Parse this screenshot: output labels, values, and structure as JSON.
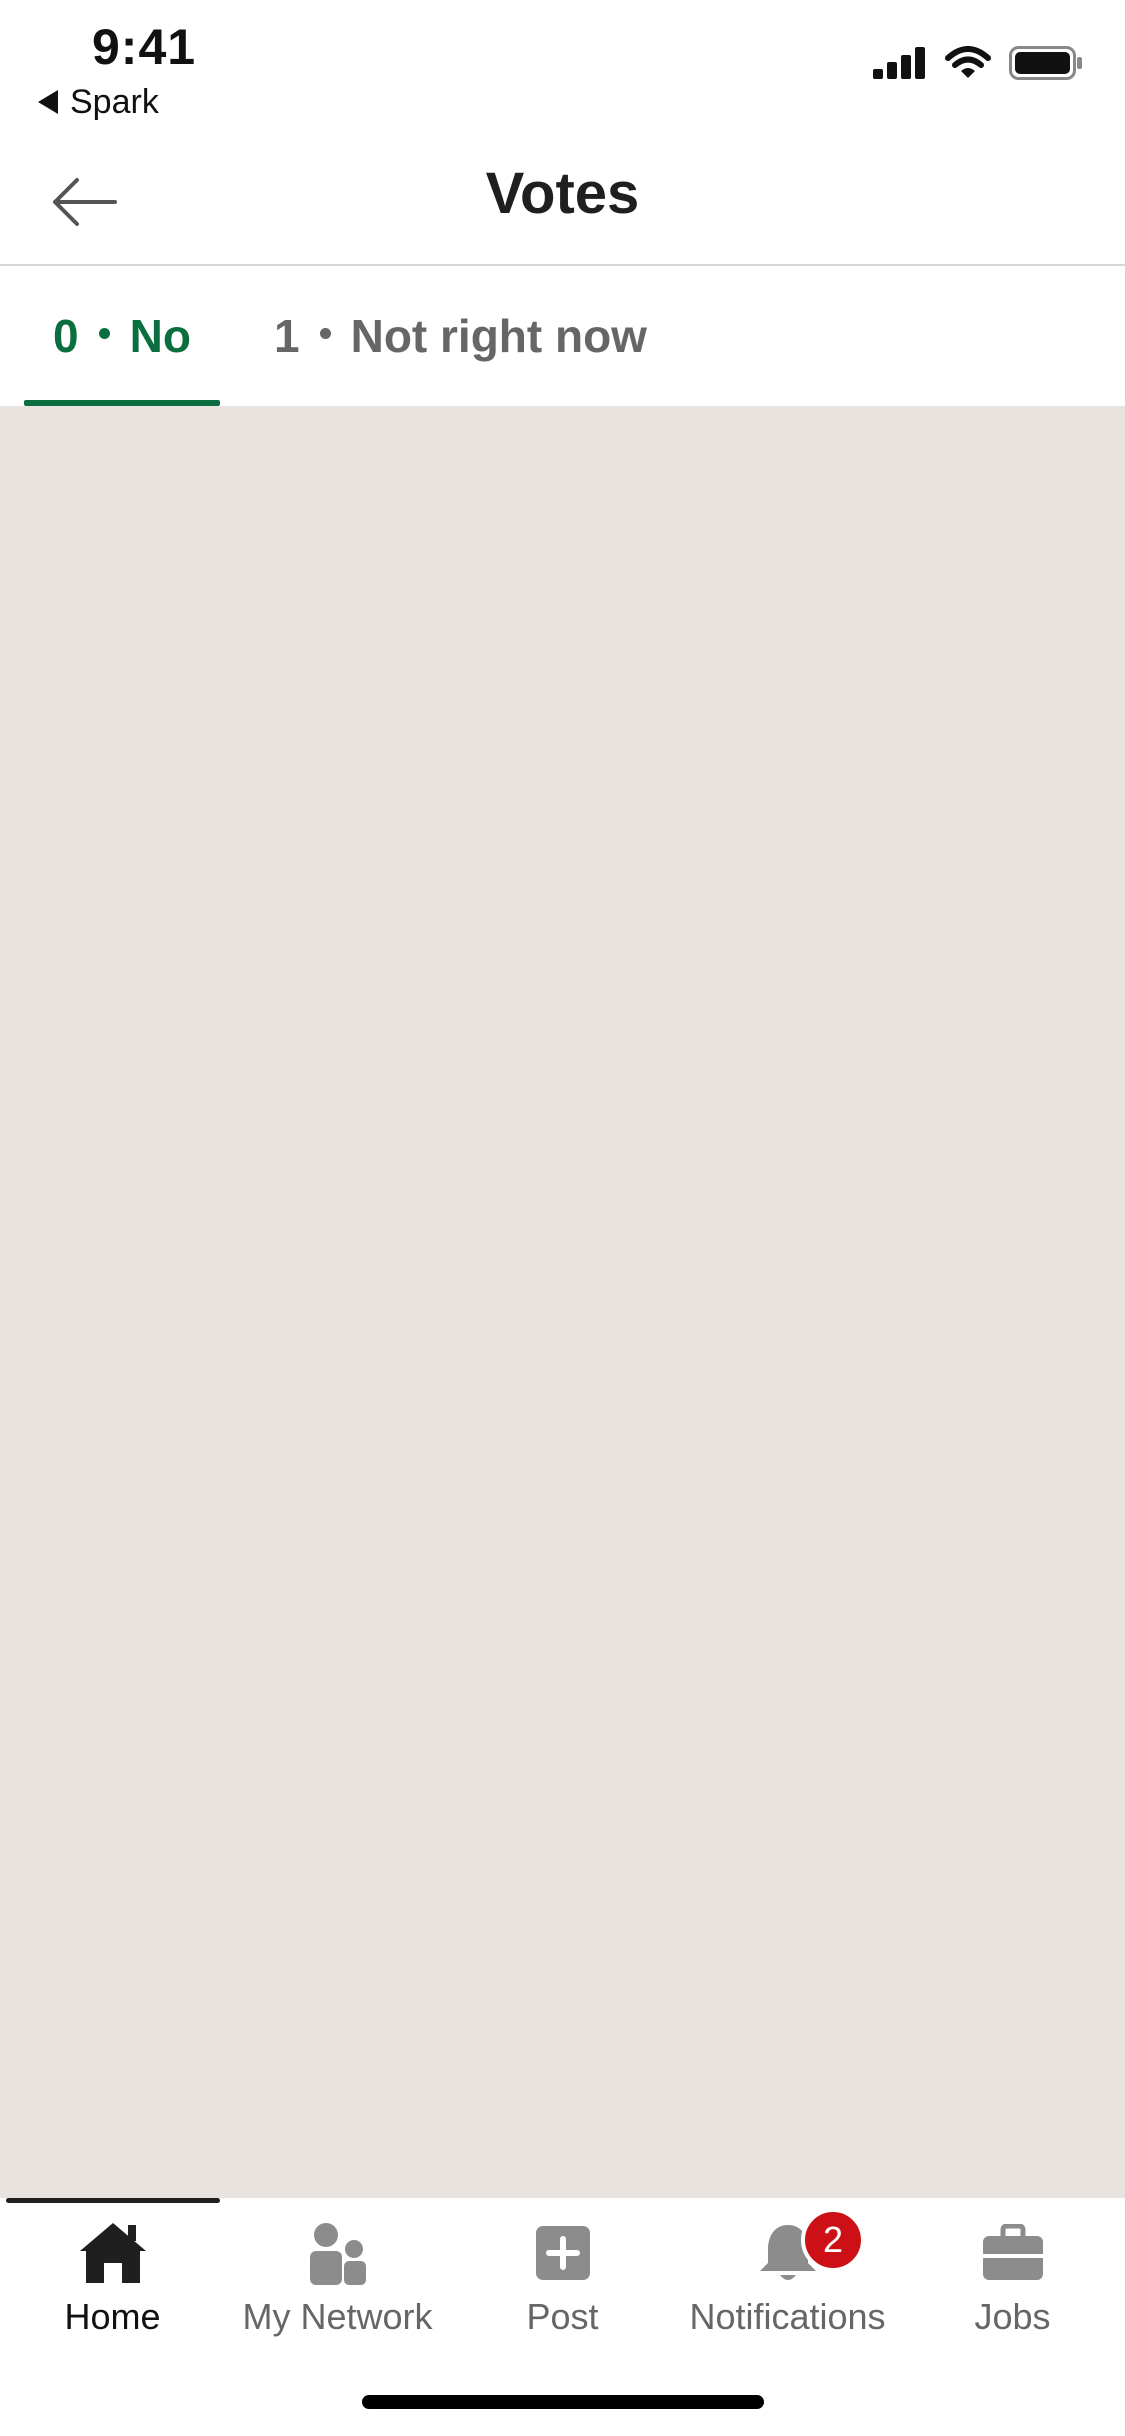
{
  "status_bar": {
    "time": "9:41",
    "back_app": "Spark"
  },
  "header": {
    "title": "Votes"
  },
  "tabs": [
    {
      "count": "0",
      "label": "No",
      "selected": true
    },
    {
      "count": "1",
      "label": "Not right now",
      "selected": false
    }
  ],
  "bottom_nav": {
    "items": [
      {
        "label": "Home",
        "icon": "home-icon",
        "active": true
      },
      {
        "label": "My Network",
        "icon": "my-network-icon",
        "active": false
      },
      {
        "label": "Post",
        "icon": "post-icon",
        "active": false
      },
      {
        "label": "Notifications",
        "icon": "bell-icon",
        "active": false,
        "badge": "2"
      },
      {
        "label": "Jobs",
        "icon": "briefcase-icon",
        "active": false
      }
    ]
  },
  "colors": {
    "accent": "#0b6e3f",
    "content_bg": "#e8e3de",
    "badge": "#cc1016",
    "inactive_text": "#666666"
  }
}
